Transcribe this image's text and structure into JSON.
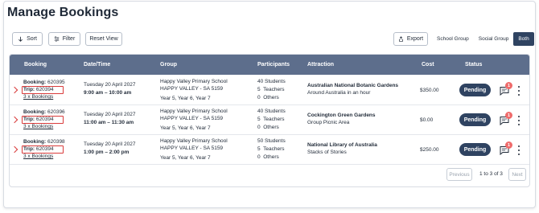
{
  "page": {
    "title": "Manage Bookings"
  },
  "toolbar": {
    "sort_label": "Sort",
    "filter_label": "Filter",
    "reset_label": "Reset View",
    "export_label": "Export",
    "segments": [
      "School Group",
      "Social Group",
      "Both"
    ],
    "active_segment": "Both"
  },
  "table": {
    "headers": [
      "Booking",
      "Date/Time",
      "Group",
      "Participants",
      "Attraction",
      "Cost",
      "Status"
    ],
    "rows": [
      {
        "booking_label": "Booking:",
        "booking_id": "620395",
        "trip_label": "Trip:",
        "trip_id": "620394",
        "bookings_link": "3 x Bookings",
        "date": "Tuesday 20 April 2027",
        "time": "9:00 am – 10:00 am",
        "group_name": "Happy Valley Primary School",
        "group_location": "HAPPY VALLEY - SA 5159",
        "group_years": "Year 5, Year 6, Year 7",
        "students": "40 Students",
        "teachers": "5  Teachers",
        "others": "0  Others",
        "attraction_name": "Australian National Botanic Gardens",
        "attraction_detail": "Around Australia in an hour",
        "cost": "$350.00",
        "status": "Pending",
        "badge": "1"
      },
      {
        "booking_label": "Booking:",
        "booking_id": "620396",
        "trip_label": "Trip:",
        "trip_id": "620394",
        "bookings_link": "3 x Bookings",
        "date": "Tuesday 20 April 2027",
        "time": "11:00 am – 11:30 am",
        "group_name": "Happy Valley Primary School",
        "group_location": "HAPPY VALLEY - SA 5159",
        "group_years": "Year 5, Year 6, Year 7",
        "students": "40 Students",
        "teachers": "5  Teachers",
        "others": "0  Others",
        "attraction_name": "Cockington Green Gardens",
        "attraction_detail": "Group Picnic Area",
        "cost": "$0.00",
        "status": "Pending",
        "badge": "1"
      },
      {
        "booking_label": "Booking:",
        "booking_id": "620398",
        "trip_label": "Trip:",
        "trip_id": "620394",
        "bookings_link": "3 x Bookings",
        "date": "Tuesday 20 April 2027",
        "time": "1:00 pm – 2:00 pm",
        "group_name": "Happy Valley Primary School",
        "group_location": "HAPPY VALLEY - SA 5159",
        "group_years": "Year 5, Year 6, Year 7",
        "students": "50 Students",
        "teachers": "5  Teachers",
        "others": "0  Others",
        "attraction_name": "National Library of Australia",
        "attraction_detail": "Stacks of Stories",
        "cost": "$250.00",
        "status": "Pending",
        "badge": "1"
      }
    ]
  },
  "pagination": {
    "previous_label": "Previous",
    "info": "1 to 3 of 3",
    "next_label": "Next"
  },
  "icons": {
    "sort": "arrow-down-icon",
    "filter": "sliders-icon",
    "export": "export-icon",
    "chat": "chat-icon",
    "more": "kebab-icon"
  },
  "colors": {
    "header_bg": "#5d6e8c",
    "status_pending": "#2f4361",
    "badge": "#ef6b6b",
    "highlight": "#d93b3b"
  }
}
